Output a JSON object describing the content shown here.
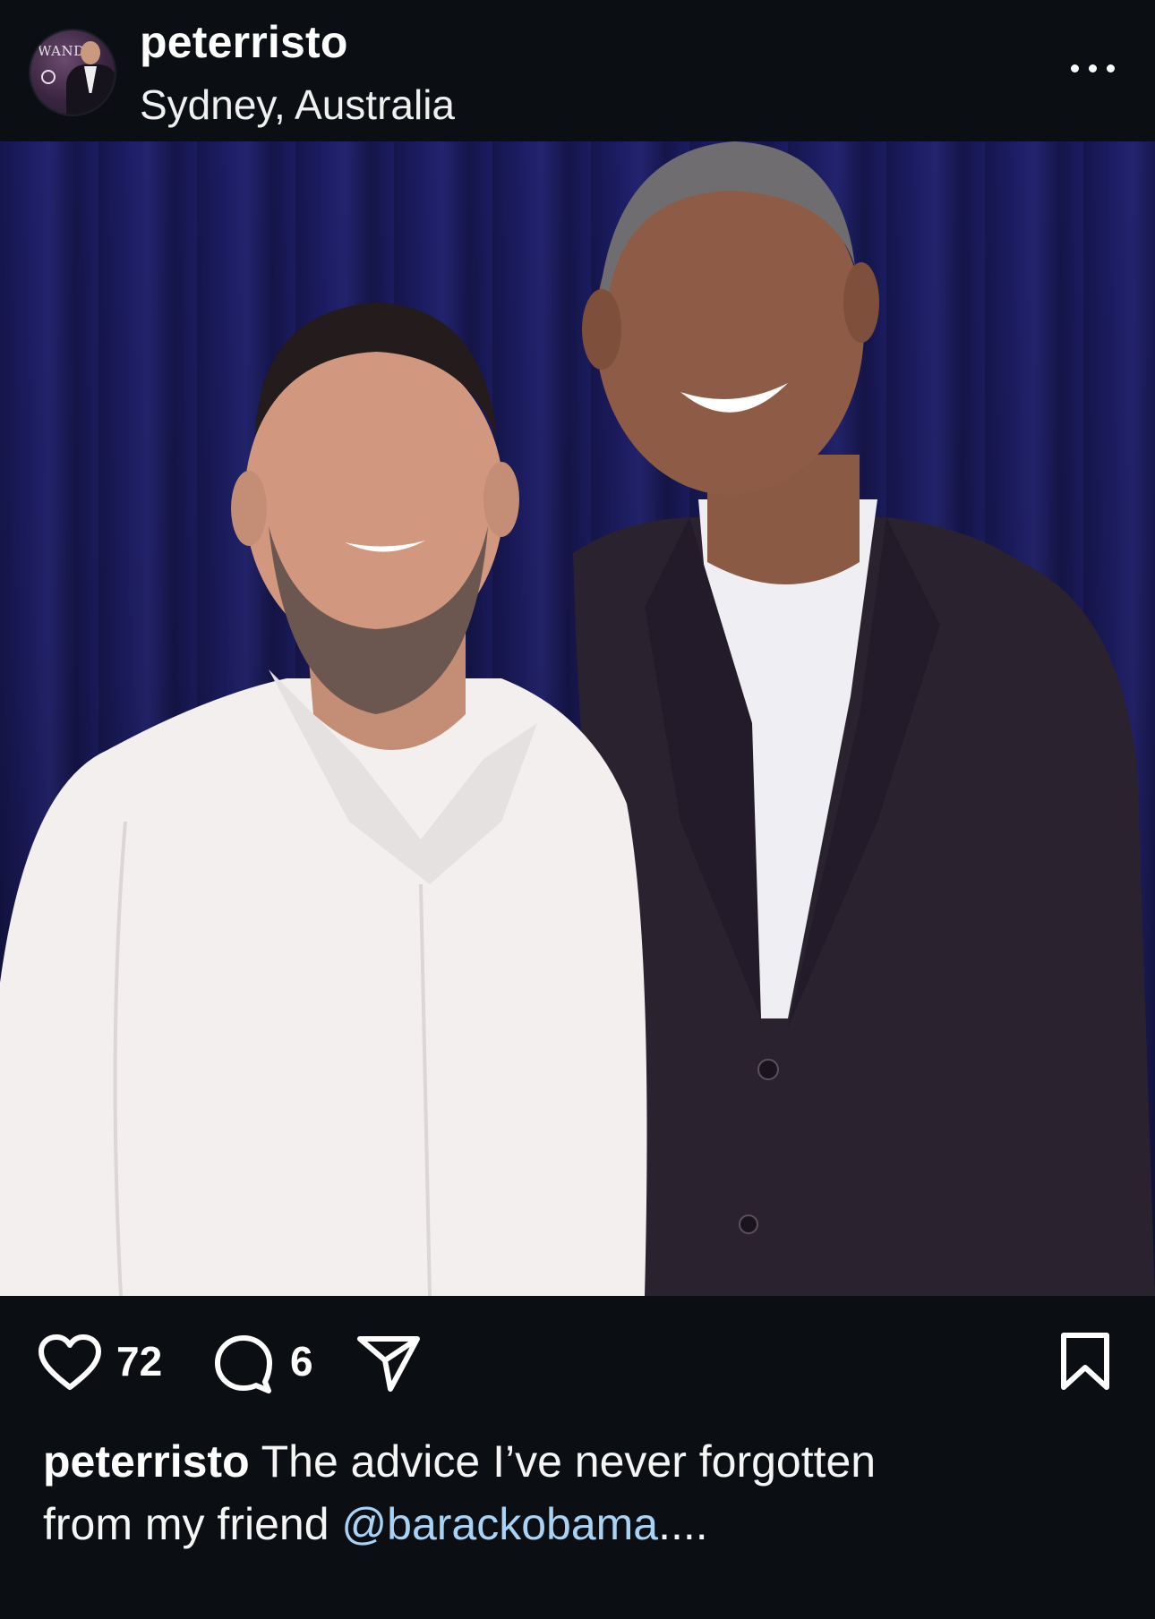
{
  "post": {
    "username": "peterristo",
    "location": "Sydney, Australia",
    "avatar_text": "WAND",
    "more_icon": "more-horizontal-icon"
  },
  "actions": {
    "likes": "72",
    "comments": "6",
    "icons": [
      "heart-icon",
      "comment-icon",
      "share-icon",
      "bookmark-icon"
    ]
  },
  "caption": {
    "username": "peterristo",
    "text_line1": " The advice I’ve never forgotten",
    "text_line2": "from my friend ",
    "mention": "@barackobama",
    "ellipsis": "...."
  },
  "colors": {
    "background": "#0b0e13",
    "text": "#f5f5f5",
    "mention": "#a9d3f5",
    "curtain": "#1b1c62"
  }
}
